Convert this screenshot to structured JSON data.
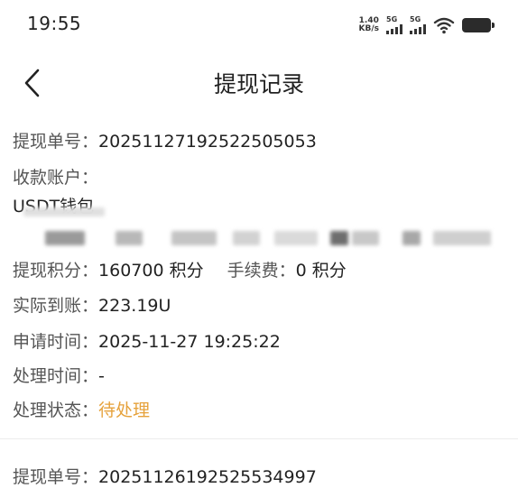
{
  "status_bar": {
    "time": "19:55",
    "net_speed_value": "1.40",
    "net_speed_unit": "KB/s",
    "sim1_label": "5G",
    "sim2_label": "5G"
  },
  "header": {
    "title": "提现记录",
    "back_icon": "chevron-left-icon"
  },
  "record": {
    "order_label": "提现单号：",
    "order_no": "20251127192522505053",
    "account_label": "收款账户：",
    "account_type": "USDT钱包",
    "points_label": "提现积分：",
    "points": "160700 积分",
    "fee_label": "手续费：",
    "fee": "0 积分",
    "received_label": "实际到账：",
    "received": "223.19U",
    "apply_time_label": "申请时间：",
    "apply_time": "2025-11-27 19:25:22",
    "process_time_label": "处理时间：",
    "process_time": "-",
    "status_label": "处理状态：",
    "status": "待处理"
  },
  "next_record": {
    "order_label": "提现单号：",
    "order_no": "20251126192525534997"
  },
  "colors": {
    "pending_status": "#e6a23c",
    "text_primary": "#222222",
    "text_label": "#555555"
  }
}
